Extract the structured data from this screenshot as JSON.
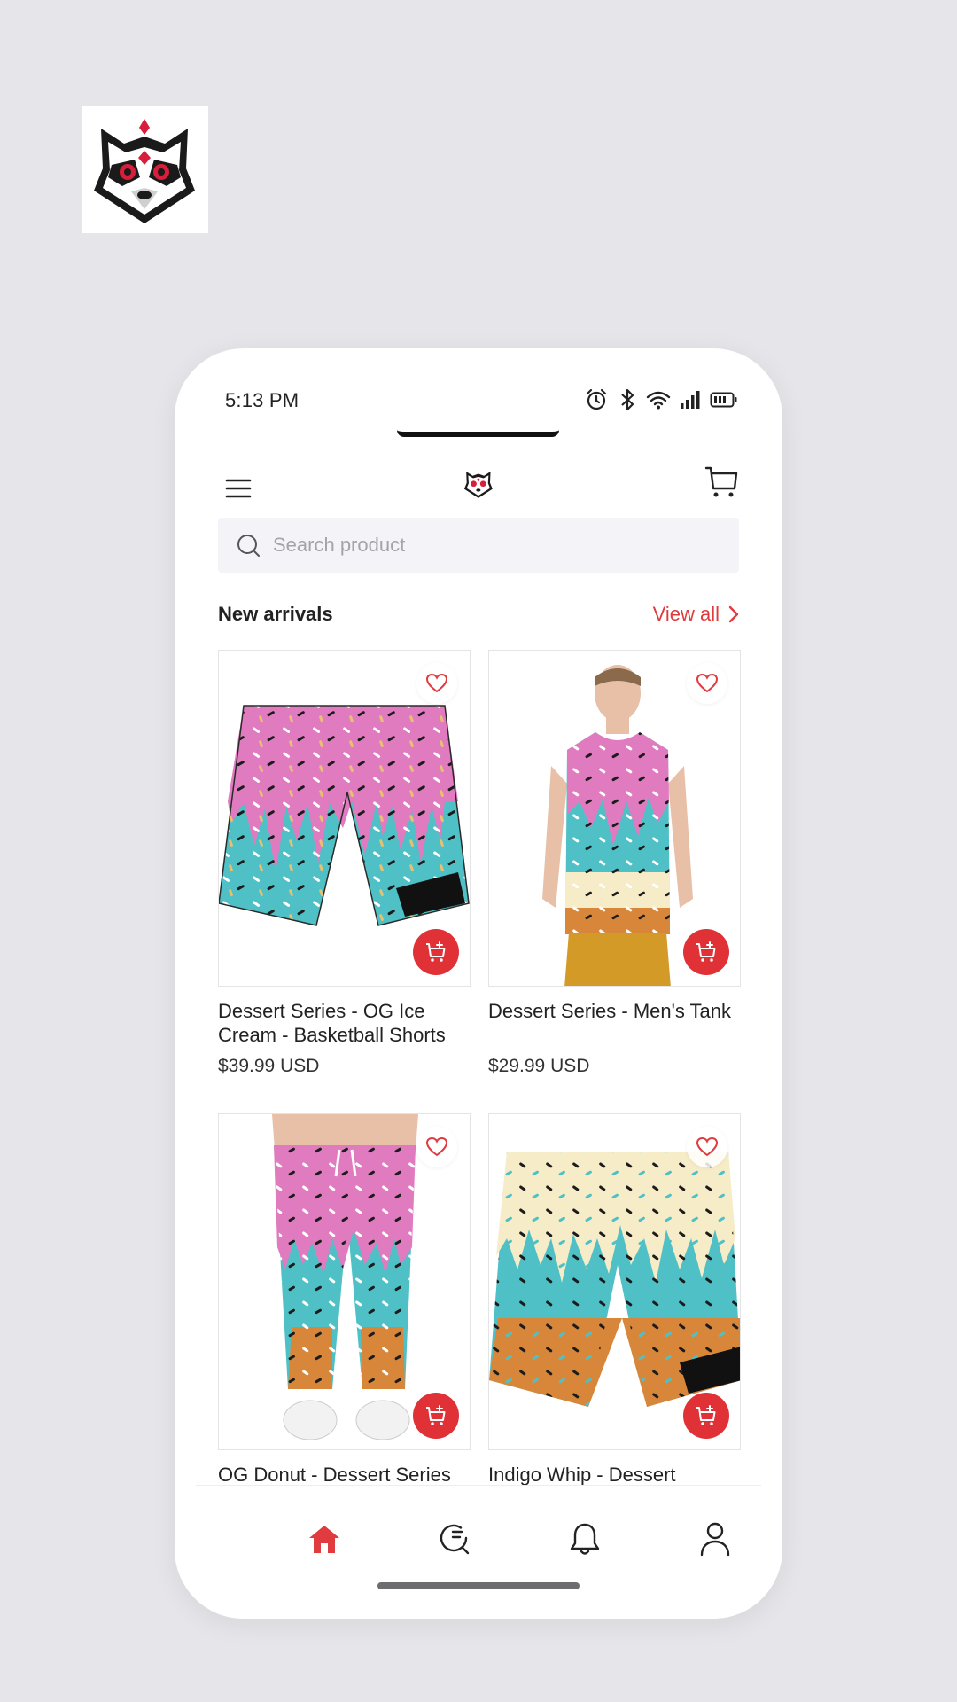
{
  "status": {
    "time": "5:13 PM"
  },
  "search": {
    "placeholder": "Search product"
  },
  "section": {
    "title": "New arrivals",
    "view_all": "View all"
  },
  "products": [
    {
      "name": "Dessert Series - OG Ice Cream -  Basketball Shorts",
      "price": "$39.99 USD"
    },
    {
      "name": "Dessert Series - Men's Tank",
      "price": "$29.99 USD"
    },
    {
      "name": "OG Donut - Dessert Series",
      "price": ""
    },
    {
      "name": "Indigo Whip - Dessert",
      "price": ""
    }
  ],
  "nav": {
    "items": [
      "home-icon",
      "search-history-icon",
      "bell-icon",
      "user-icon"
    ],
    "active": "home"
  },
  "colors": {
    "accent": "#e03c3f",
    "background": "#e6e5e9",
    "pink": "#e07bc0",
    "teal": "#4fc1c6",
    "cream": "#f6ecc8",
    "waffle": "#d8863a"
  }
}
